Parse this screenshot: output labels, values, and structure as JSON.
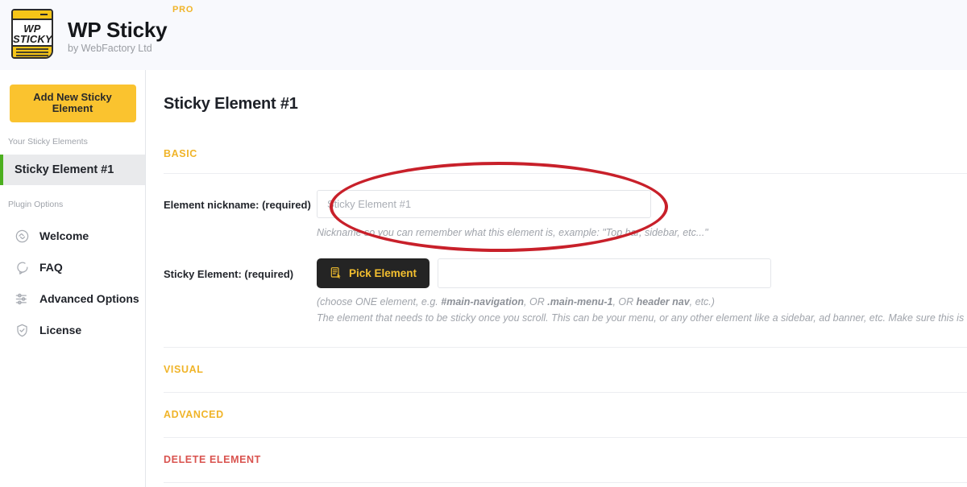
{
  "header": {
    "logo_line1": "WP",
    "logo_line2": "STICKY",
    "brand_title": "WP Sticky",
    "brand_subtitle": "by WebFactory Ltd",
    "pro_badge": "PRO"
  },
  "sidebar": {
    "add_button": "Add New Sticky Element",
    "elements_section_label": "Your Sticky Elements",
    "active_element": "Sticky Element #1",
    "options_section_label": "Plugin Options",
    "menu": [
      {
        "label": "Welcome",
        "icon": "handshake-icon"
      },
      {
        "label": "FAQ",
        "icon": "speech-bubble-icon"
      },
      {
        "label": "Advanced Options",
        "icon": "sliders-icon"
      },
      {
        "label": "License",
        "icon": "shield-check-icon"
      }
    ]
  },
  "main": {
    "page_title": "Sticky Element #1",
    "sections": {
      "basic": "BASIC",
      "visual": "VISUAL",
      "advanced": "ADVANCED",
      "delete": "DELETE ELEMENT"
    },
    "nickname_field": {
      "label": "Element nickname: (required)",
      "placeholder": "Sticky Element #1",
      "value": "",
      "hint": "Nickname so you can remember what this element is, example: \"Top bar, sidebar, etc...\""
    },
    "sticky_element_field": {
      "label": "Sticky Element: (required)",
      "button_label": "Pick Element",
      "button_icon": "element-picker-icon",
      "input_value": "",
      "input_placeholder": "",
      "hint_line1_prefix": "(choose ONE element, e.g. ",
      "hint_line1_b1": "#main-navigation",
      "hint_line1_mid1": ", OR ",
      "hint_line1_b2": ".main-menu-1",
      "hint_line1_mid2": ", OR ",
      "hint_line1_b3": "header nav",
      "hint_line1_suffix": ", etc.)",
      "hint_line2": "The element that needs to be sticky once you scroll. This can be your menu, or any other element like a sidebar, ad banner, etc. Make sure this is a unique identifier."
    }
  },
  "annotation": {
    "shape": "ellipse",
    "color": "#c8202a"
  },
  "colors": {
    "accent_gold": "#fac32f",
    "section_gold": "#f0b429",
    "danger_red": "#d9534f",
    "active_green": "#4caf1f",
    "dark_button": "#242424",
    "header_bg": "#f8f9fd",
    "annotation_red": "#c8202a"
  }
}
